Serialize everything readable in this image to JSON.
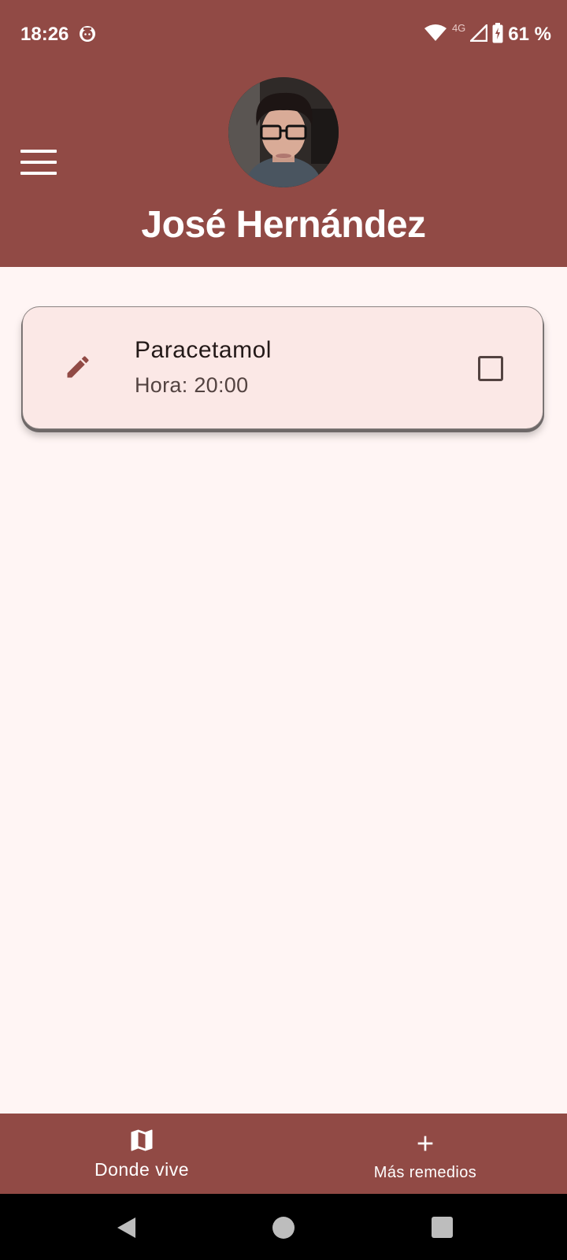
{
  "status_bar": {
    "time": "18:26",
    "network": "4G",
    "battery": "61 %"
  },
  "header": {
    "menu_icon": "hamburger-menu-icon",
    "user_name": "José Hernández"
  },
  "medications": [
    {
      "name": "Paracetamol",
      "time_text": "Hora: 20:00",
      "checked": false
    }
  ],
  "bottom_nav": {
    "left": {
      "icon": "map-icon",
      "label": "Donde vive"
    },
    "right": {
      "icon": "plus-icon",
      "label": "Más remedios"
    }
  },
  "colors": {
    "primary": "#914A45",
    "background": "#FFF5F4",
    "card": "#FBE8E6"
  }
}
